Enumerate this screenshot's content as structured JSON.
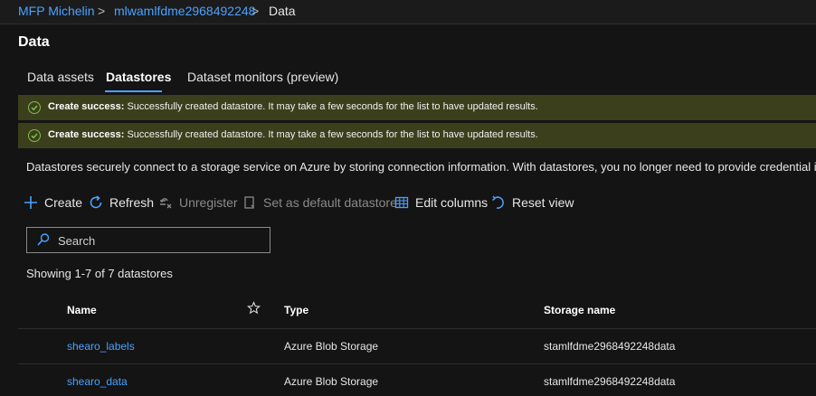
{
  "breadcrumb": {
    "items": [
      "MFP Michelin",
      "mlwamlfdme2968492248",
      "Data"
    ],
    "separator": ">"
  },
  "page": {
    "title": "Data"
  },
  "tabs": [
    {
      "label": "Data assets"
    },
    {
      "label": "Datastores"
    },
    {
      "label": "Dataset monitors (preview)"
    }
  ],
  "notifications": [
    {
      "title": "Create success:",
      "message": "Successfully created datastore. It may take a few seconds for the list to have updated results."
    },
    {
      "title": "Create success:",
      "message": "Successfully created datastore. It may take a few seconds for the list to have updated results."
    }
  ],
  "description": "Datastores securely connect to a storage service on Azure by storing connection information. With datastores, you no longer need to provide credential infor",
  "toolbar": {
    "create": "Create",
    "refresh": "Refresh",
    "unregister": "Unregister",
    "set_default": "Set as default datastore",
    "edit_columns": "Edit columns",
    "reset_view": "Reset view"
  },
  "search": {
    "placeholder": "Search"
  },
  "list": {
    "count_text": "Showing 1-7 of 7 datastores"
  },
  "table": {
    "columns": [
      "Name",
      "Type",
      "Storage name"
    ],
    "rows": [
      {
        "name": "shearo_labels",
        "type": "Azure Blob Storage",
        "storage": "stamlfdme2968492248data"
      },
      {
        "name": "shearo_data",
        "type": "Azure Blob Storage",
        "storage": "stamlfdme2968492248data"
      }
    ]
  },
  "colors": {
    "accent": "#4aa2ff",
    "success_bg": "#3b3f1c",
    "success_icon": "#7ec04a",
    "background": "#141414"
  },
  "icons": [
    "plus-icon",
    "refresh-icon",
    "unregister-icon",
    "set-default-icon",
    "edit-columns-icon",
    "reset-view-icon",
    "search-icon",
    "star-icon",
    "check-circle-icon"
  ]
}
